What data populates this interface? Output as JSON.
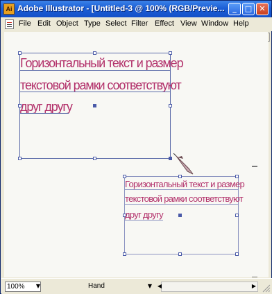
{
  "window": {
    "title": "Adobe Illustrator - [Untitled-3 @ 100% (RGB/Previe...",
    "app_icon_text": "Ai",
    "minimize_glyph": "_",
    "maximize_glyph": "□",
    "close_glyph": "✕"
  },
  "menu": {
    "items": [
      "File",
      "Edit",
      "Object",
      "Type",
      "Select",
      "Filter",
      "Effect",
      "View",
      "Window",
      "Help"
    ]
  },
  "doc_controls": {
    "minimize_glyph": "_",
    "close_glyph": "✕"
  },
  "text_frames": [
    {
      "lines": [
        "Горизонтальный текст и размер",
        "текстовой рамки соответствуют",
        "друг другу"
      ]
    },
    {
      "lines": [
        "Горизонтальный текст и размер",
        "текстовой рамки соответствуют",
        "друг другу"
      ]
    }
  ],
  "status": {
    "zoom": "100%",
    "zoom_arrow": "▼",
    "tool": "Hand",
    "tool_arrow": "▼",
    "left_arrow": "◀",
    "right_arrow": "▶"
  },
  "colors": {
    "text": "#b2306a",
    "selection": "#5a6aa8"
  }
}
